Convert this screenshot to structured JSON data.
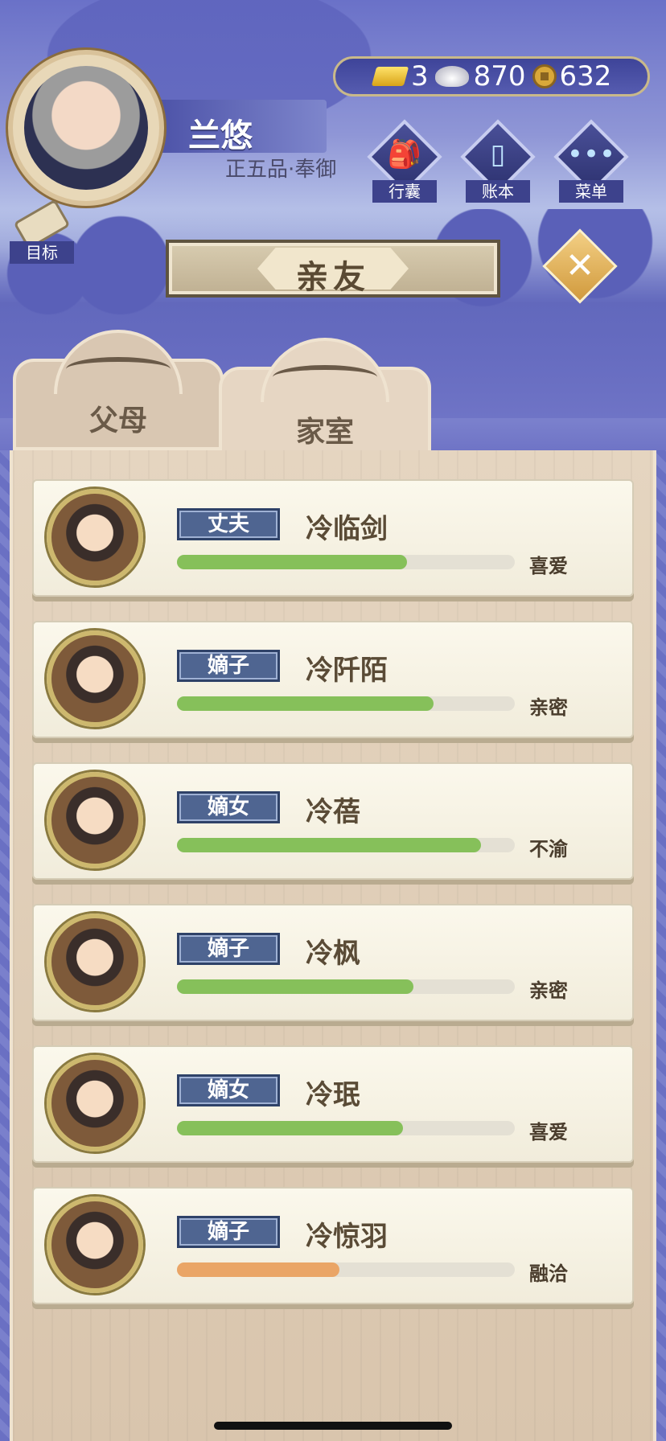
{
  "player": {
    "name": "兰悠",
    "rank": "正五品·奉御"
  },
  "currency": {
    "gold": "3",
    "silver": "870",
    "coins": "632"
  },
  "menu": {
    "bag": "行囊",
    "ledger": "账本",
    "menu": "菜单",
    "goal": "目标"
  },
  "title": "亲友",
  "tabs": {
    "parents": "父母",
    "family": "家室"
  },
  "members": [
    {
      "relation": "丈夫",
      "name": "冷临剑",
      "mood": "喜爱",
      "favor": 0.68,
      "bar_color": "#86c05a"
    },
    {
      "relation": "嫡子",
      "name": "冷阡陌",
      "mood": "亲密",
      "favor": 0.76,
      "bar_color": "#86c05a"
    },
    {
      "relation": "嫡女",
      "name": "冷蓓",
      "mood": "不渝",
      "favor": 0.9,
      "bar_color": "#86c05a"
    },
    {
      "relation": "嫡子",
      "name": "冷枫",
      "mood": "亲密",
      "favor": 0.7,
      "bar_color": "#86c05a"
    },
    {
      "relation": "嫡女",
      "name": "冷珉",
      "mood": "喜爱",
      "favor": 0.67,
      "bar_color": "#86c05a"
    },
    {
      "relation": "嫡子",
      "name": "冷惊羽",
      "mood": "融洽",
      "favor": 0.48,
      "bar_color": "#eaa566"
    }
  ]
}
